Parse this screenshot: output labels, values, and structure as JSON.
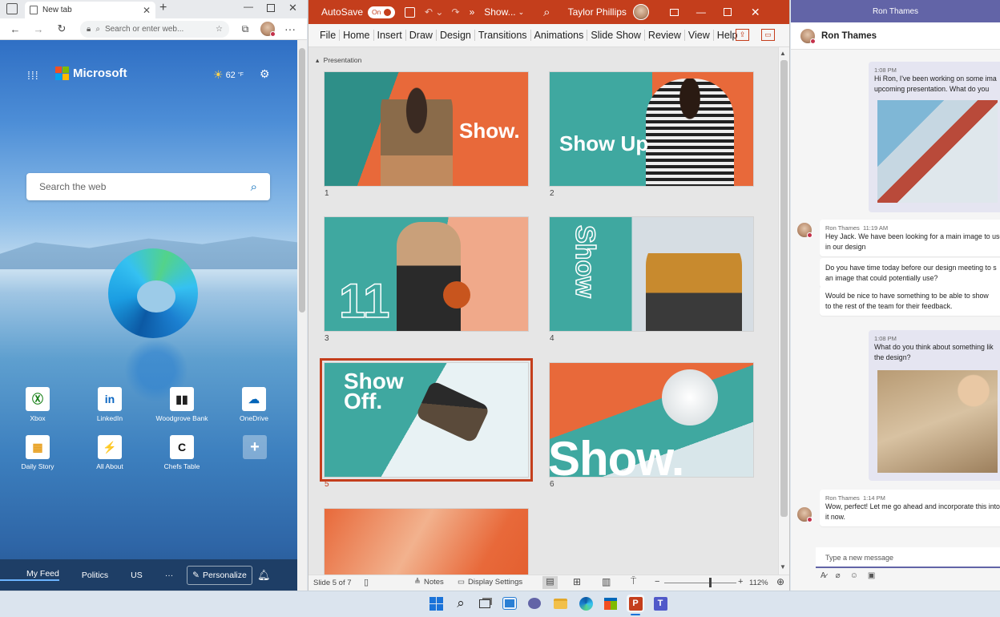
{
  "edge": {
    "tab_title": "New tab",
    "address_placeholder": "Search or enter web...",
    "brand": "Microsoft",
    "weather": "62",
    "weather_unit": "°F",
    "search_placeholder": "Search the web",
    "quick_links": [
      {
        "label": "Xbox",
        "icon": "xbox-icon",
        "glyph": "Ⓧ",
        "color": "#107c10"
      },
      {
        "label": "LinkedIn",
        "icon": "linkedin-icon",
        "glyph": "in",
        "color": "#0a66c2"
      },
      {
        "label": "Woodgrove Bank",
        "icon": "bank-icon",
        "glyph": "▮▮",
        "color": "#222222"
      },
      {
        "label": "OneDrive",
        "icon": "cloud-icon",
        "glyph": "☁",
        "color": "#0364b8"
      },
      {
        "label": "Daily Story",
        "icon": "story-icon",
        "glyph": "▦",
        "color": "#e8a020"
      },
      {
        "label": "All About",
        "icon": "bolt-icon",
        "glyph": "⚡",
        "color": "#f0a000"
      },
      {
        "label": "Chefs Table",
        "icon": "chefs-table-icon",
        "glyph": "C",
        "color": "#111111"
      }
    ],
    "feed_tabs": [
      "My Feed",
      "Politics",
      "US",
      "···"
    ],
    "personalize_label": "Personalize"
  },
  "ppt": {
    "autosave_label": "AutoSave",
    "autosave_state": "On",
    "doc_title": "Show...",
    "user_name": "Taylor Phillips",
    "ribbon_tabs": [
      "File",
      "Home",
      "Insert",
      "Draw",
      "Design",
      "Transitions",
      "Animations",
      "Slide Show",
      "Review",
      "View",
      "Help"
    ],
    "section_label": "Presentation",
    "slides": [
      {
        "num": "1",
        "text": "Show.",
        "selected": false
      },
      {
        "num": "2",
        "text": "Show Up",
        "selected": false
      },
      {
        "num": "3",
        "text": "11",
        "selected": false
      },
      {
        "num": "4",
        "text": "Show",
        "selected": false
      },
      {
        "num": "5",
        "text": "Show Off.",
        "selected": true
      },
      {
        "num": "6",
        "text": "Show.",
        "selected": false
      },
      {
        "num": "7",
        "text": "",
        "selected": false
      }
    ],
    "status": {
      "slide_info": "Slide 5 of 7",
      "notes_label": "Notes",
      "display_label": "Display Settings",
      "zoom": "112%",
      "zoom_fraction": 0.62
    }
  },
  "teams": {
    "window_title": "Ron Thames",
    "contact_name": "Ron Thames",
    "messages": [
      {
        "who": "me",
        "time": "1:08 PM",
        "lines": [
          "Hi Ron, I've been working on some ima",
          "upcoming presentation. What do you"
        ]
      },
      {
        "who": "them",
        "sender": "Ron Thames",
        "time": "11:19 AM",
        "lines": [
          "Hey Jack. We have been looking for a main image to use",
          "in our design"
        ]
      },
      {
        "who": "them",
        "lines": [
          "Do you have time today before our design meeting to s",
          "an image that could potentially use?"
        ]
      },
      {
        "who": "them",
        "lines": [
          "Would be nice to have something to be able to show",
          "to the rest of the team for their feedback."
        ]
      },
      {
        "who": "me",
        "time": "1:08 PM",
        "lines": [
          "What do you think about something lik",
          "the design?"
        ]
      },
      {
        "who": "them",
        "sender": "Ron Thames",
        "time": "1:14 PM",
        "lines": [
          "Wow, perfect! Let me go ahead and incorporate this into",
          "it now."
        ]
      }
    ],
    "compose_placeholder": "Type a new message"
  },
  "colors": {
    "ppt_accent": "#c43e1c",
    "teams_accent": "#6264a7",
    "slide_orange": "#e8693a",
    "slide_teal": "#3fa8a0"
  }
}
